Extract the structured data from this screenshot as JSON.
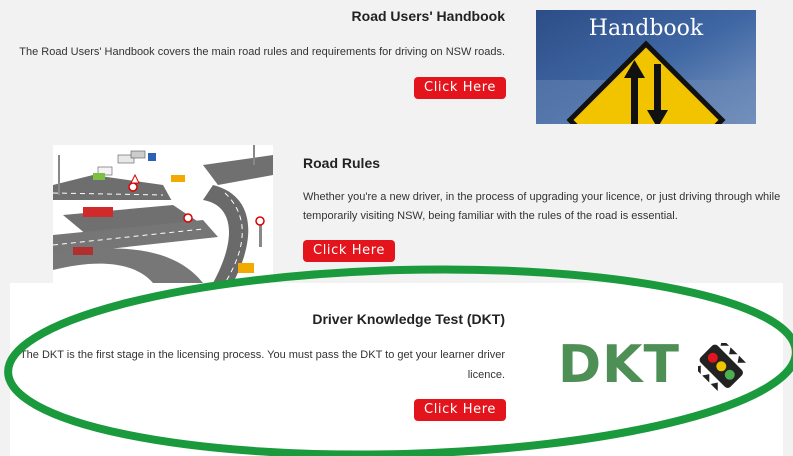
{
  "sections": [
    {
      "title": "Road Users' Handbook",
      "description": "The Road Users' Handbook covers the main road rules and requirements for driving on NSW roads.",
      "button_label": "Click Here",
      "image_text": "Handbook"
    },
    {
      "title": "Road Rules",
      "description_line1": "Whether you're a new driver, in the process of upgrading your licence, or just driving through while",
      "description_line2": "temporarily visiting NSW, being familiar with the rules of the road is essential.",
      "button_label": "Click Here"
    },
    {
      "title": "Driver Knowledge Test (DKT)",
      "description_line1": "The DKT is the first stage in the licensing process. You must pass the DKT to get your learner driver",
      "description_line2": "licence.",
      "button_label": "Click Here",
      "logo_text": "DKT"
    }
  ],
  "colors": {
    "button": "#e3141b",
    "highlight_oval": "#1a9a3c",
    "dkt_logo": "#4e8f56",
    "sign_yellow": "#f2c400"
  }
}
